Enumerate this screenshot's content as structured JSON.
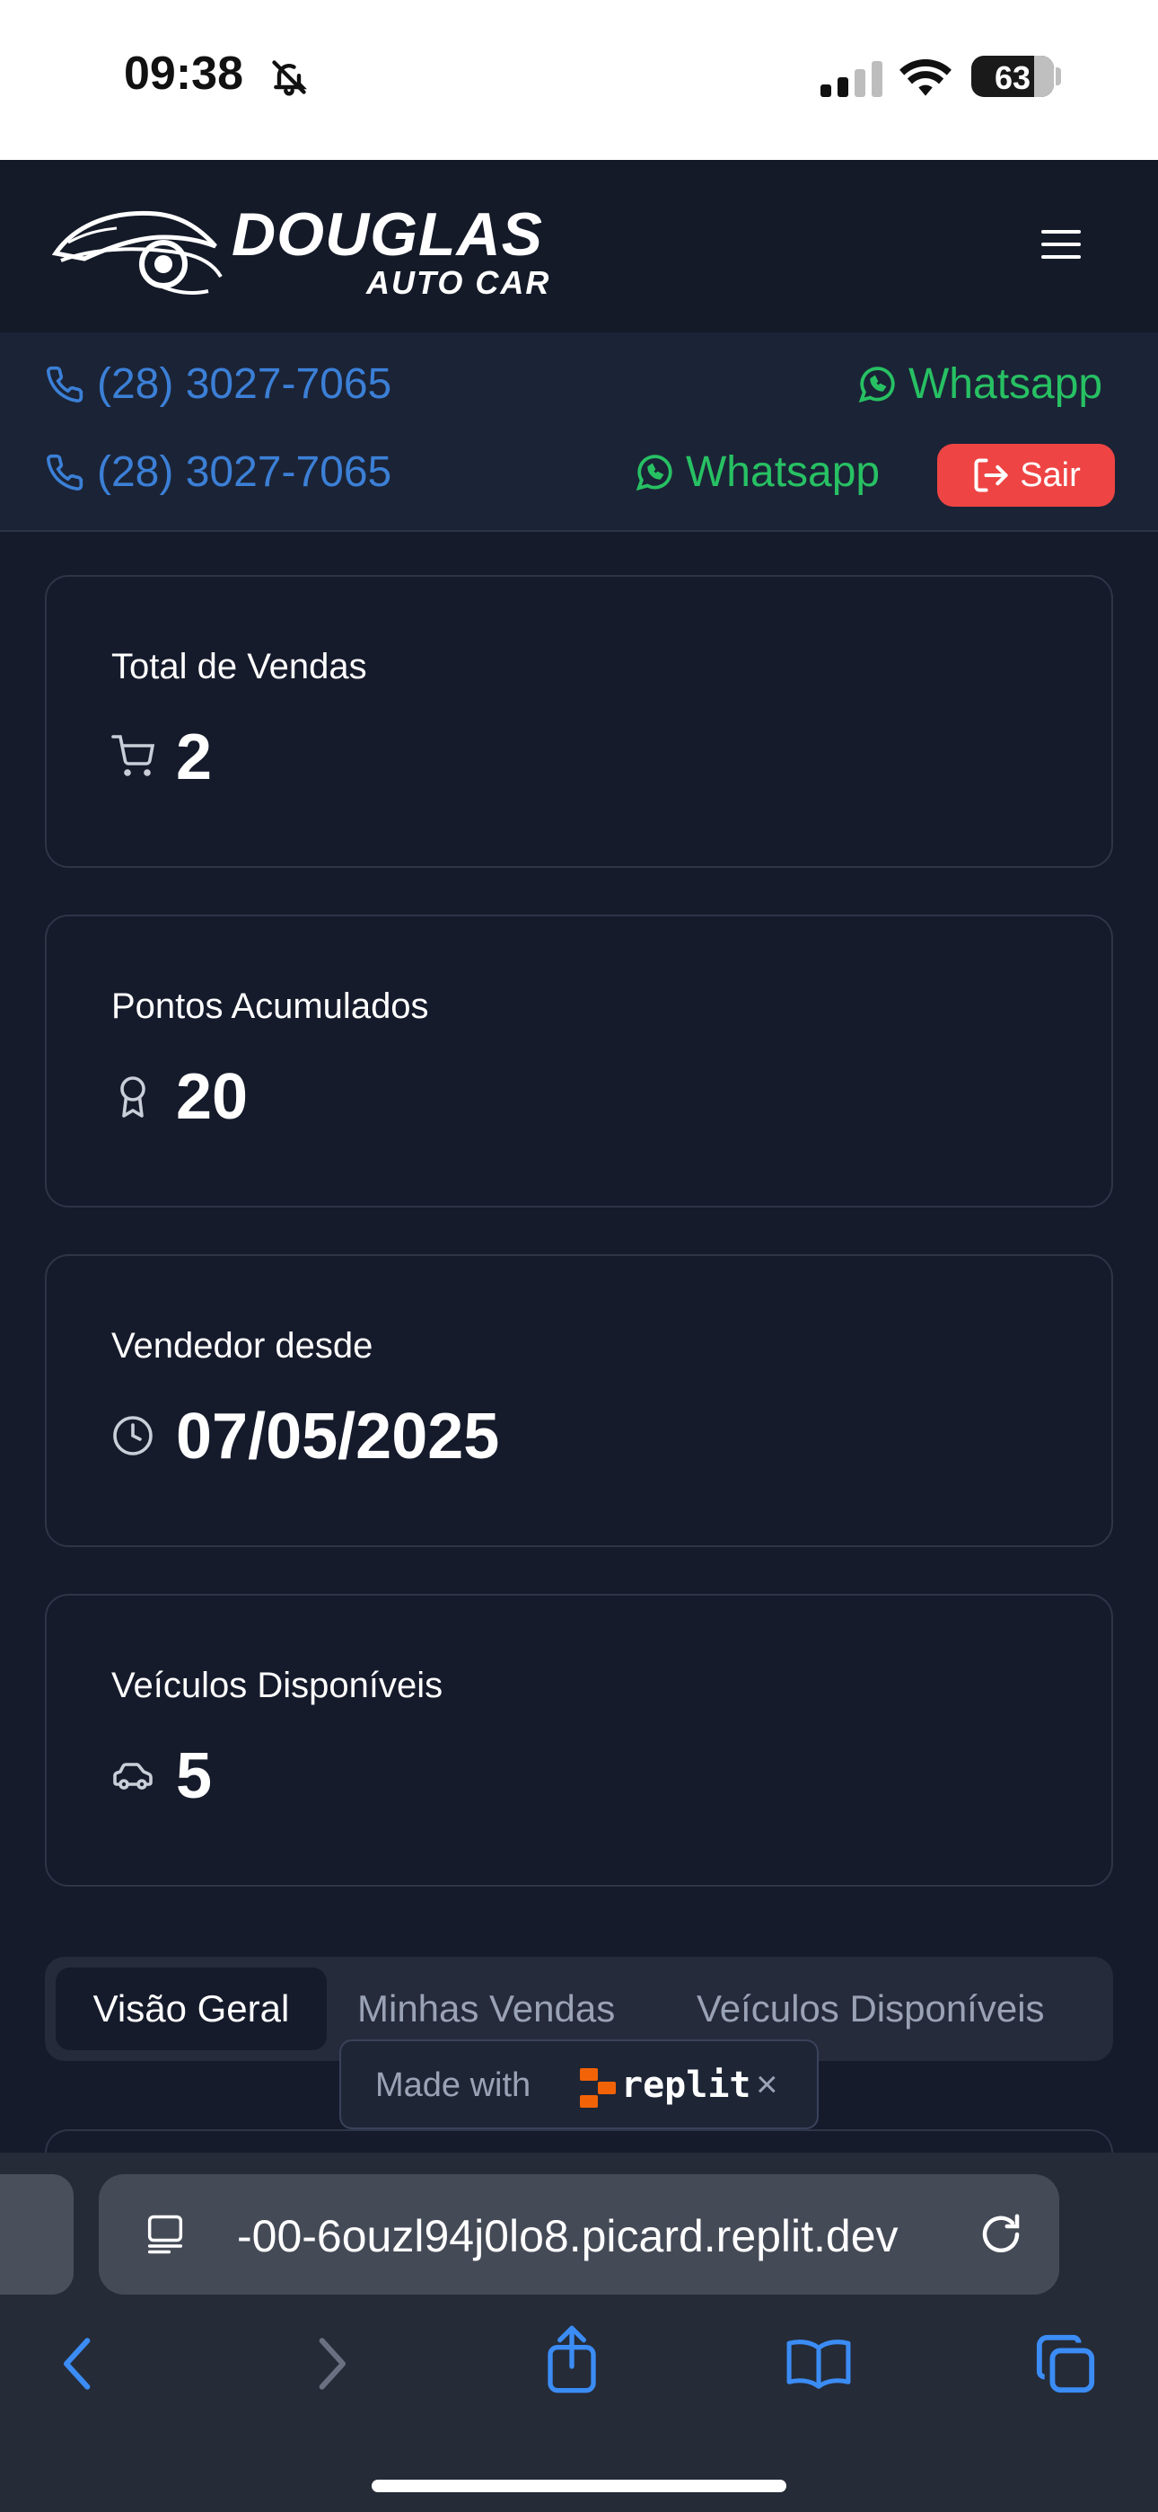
{
  "status_bar": {
    "time": "09:38",
    "battery": "63"
  },
  "header": {
    "brand": "DOUGLAS",
    "brand_sub": "AUTO CAR",
    "menu_icon": "hamburger-icon"
  },
  "contact": {
    "phone_1": "(28) 3027-7065",
    "phone_2": "(28) 3027-7065",
    "whatsapp_1": "Whatsapp",
    "whatsapp_2": "Whatsapp",
    "logout_label": "Sair"
  },
  "stats": [
    {
      "label": "Total de Vendas",
      "value": "2",
      "icon": "cart-icon"
    },
    {
      "label": "Pontos Acumulados",
      "value": "20",
      "icon": "award-icon"
    },
    {
      "label": "Vendedor desde",
      "value": "07/05/2025",
      "icon": "clock-icon"
    },
    {
      "label": "Veículos Disponíveis",
      "value": "5",
      "icon": "car-icon"
    }
  ],
  "tabs": [
    {
      "label": "Visão Geral",
      "active": true
    },
    {
      "label": "Minhas Vendas",
      "active": false
    },
    {
      "label": "Veículos Disponíveis",
      "active": false
    }
  ],
  "badge": {
    "text": "Made with",
    "brand": "replit"
  },
  "browser": {
    "url": "-00-6ouzl94j0lo8.picard.replit.dev"
  },
  "colors": {
    "background": "#161b2b",
    "phone": "#3b7fd6",
    "whatsapp": "#27c164",
    "logout": "#ef4444"
  }
}
